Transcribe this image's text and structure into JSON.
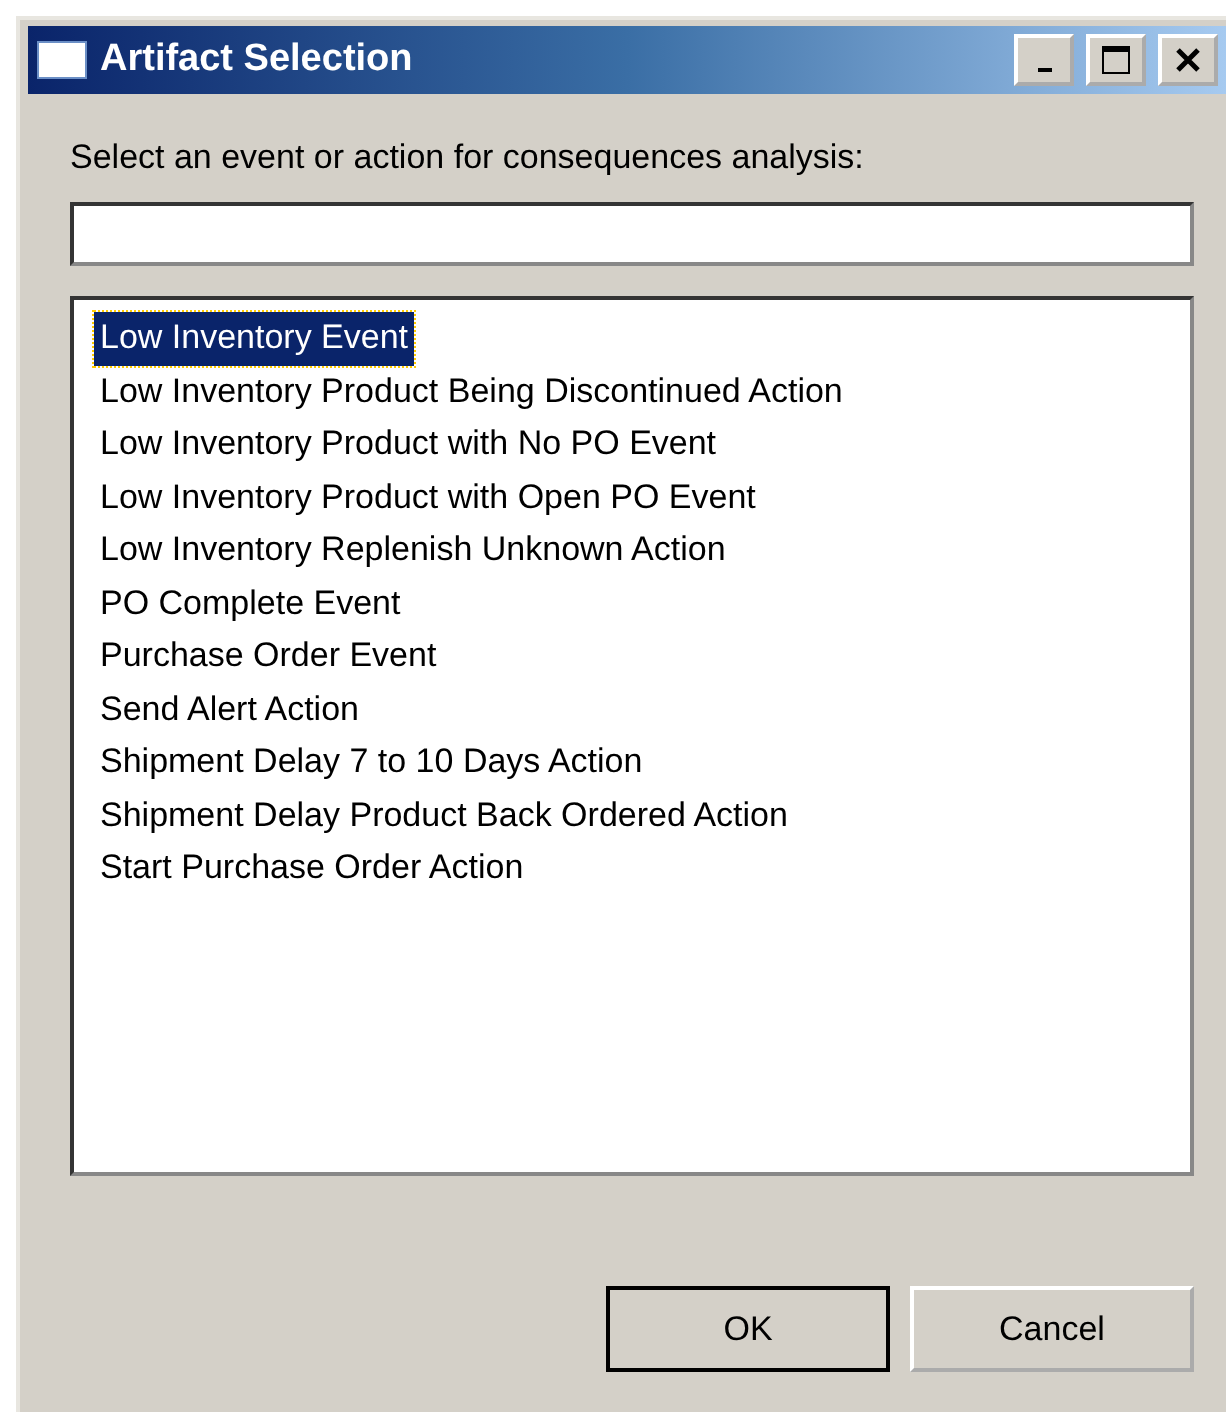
{
  "window": {
    "title": "Artifact Selection"
  },
  "prompt": "Select an event or action for consequences analysis:",
  "items": [
    {
      "label": "Low Inventory Event",
      "selected": true
    },
    {
      "label": "Low Inventory Product Being Discontinued Action",
      "selected": false
    },
    {
      "label": "Low Inventory Product with No PO Event",
      "selected": false
    },
    {
      "label": "Low Inventory Product with Open PO Event",
      "selected": false
    },
    {
      "label": "Low Inventory Replenish Unknown Action",
      "selected": false
    },
    {
      "label": "PO Complete Event",
      "selected": false
    },
    {
      "label": "Purchase Order Event",
      "selected": false
    },
    {
      "label": "Send Alert Action",
      "selected": false
    },
    {
      "label": "Shipment Delay 7 to 10 Days Action",
      "selected": false
    },
    {
      "label": "Shipment Delay Product Back Ordered Action",
      "selected": false
    },
    {
      "label": "Start Purchase Order Action",
      "selected": false
    }
  ],
  "buttons": [
    {
      "label": "OK",
      "default": true
    },
    {
      "label": "Cancel",
      "default": false
    }
  ]
}
